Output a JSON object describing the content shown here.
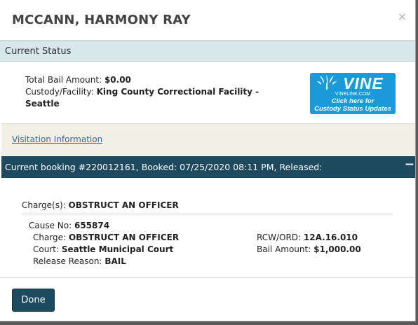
{
  "dialog": {
    "title": "MCCANN, HARMONY RAY",
    "close_glyph": "×"
  },
  "status": {
    "header": "Current Status",
    "bail_label": "Total Bail Amount:",
    "bail_value": "$0.00",
    "custody_label": "Custody/Facility:",
    "custody_value_line1": "King County Correctional Facility -",
    "custody_value_line2": "Seattle"
  },
  "vine_banner": {
    "logo_text": "VINE",
    "site_text": "VINELINK.COM",
    "cta_line1": "Click here for",
    "cta_line2": "Custody Status Updates",
    "color": "#1a9ad6",
    "icon": "vine-leaf-icon"
  },
  "visitation": {
    "link_text": "Visitation Information"
  },
  "booking": {
    "header": "Current booking #220012161, Booked: 07/25/2020 08:11 PM, Released:",
    "collapse_glyph": "−",
    "charges_label": "Charge(s):",
    "charges_value": "OBSTRUCT AN OFFICER",
    "cause_label": "Cause No:",
    "cause_value": "655874",
    "charge_label": "Charge:",
    "charge_value": "OBSTRUCT AN OFFICER",
    "court_label": "Court:",
    "court_value": "Seattle Municipal Court",
    "release_label": "Release Reason:",
    "release_value": "BAIL",
    "rcw_label": "RCW/ORD:",
    "rcw_value": "12A.16.010",
    "bail_label": "Bail Amount:",
    "bail_value": "$1,000.00"
  },
  "footer": {
    "done_label": "Done"
  },
  "colors": {
    "status_bar": "#d8e8ea",
    "booking_bar": "#1e4a5f",
    "visit_bg": "#f2efe4",
    "link": "#2b6aa8"
  }
}
